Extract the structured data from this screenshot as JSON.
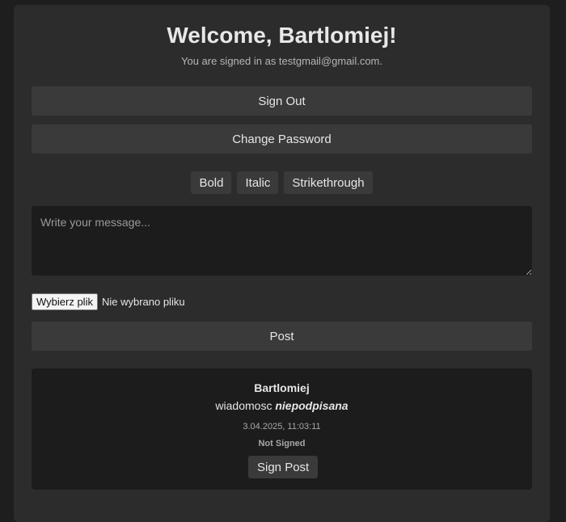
{
  "header": {
    "title": "Welcome, Bartlomiej!",
    "subtitle": "You are signed in as testgmail@gmail.com."
  },
  "account": {
    "sign_out_label": "Sign Out",
    "change_password_label": "Change Password"
  },
  "formatting": {
    "bold_label": "Bold",
    "italic_label": "Italic",
    "strikethrough_label": "Strikethrough"
  },
  "composer": {
    "message_placeholder": "Write your message...",
    "message_value": "",
    "file_button_label": "Wybierz plik",
    "file_status": "Nie wybrano pliku",
    "post_label": "Post"
  },
  "posts": [
    {
      "author": "Bartlomiej",
      "content_plain": "wiadomosc ",
      "content_emphasis": "niepodpisana",
      "timestamp": "3.04.2025, 11:03:11",
      "status": "Not Signed",
      "sign_label": "Sign Post"
    }
  ]
}
